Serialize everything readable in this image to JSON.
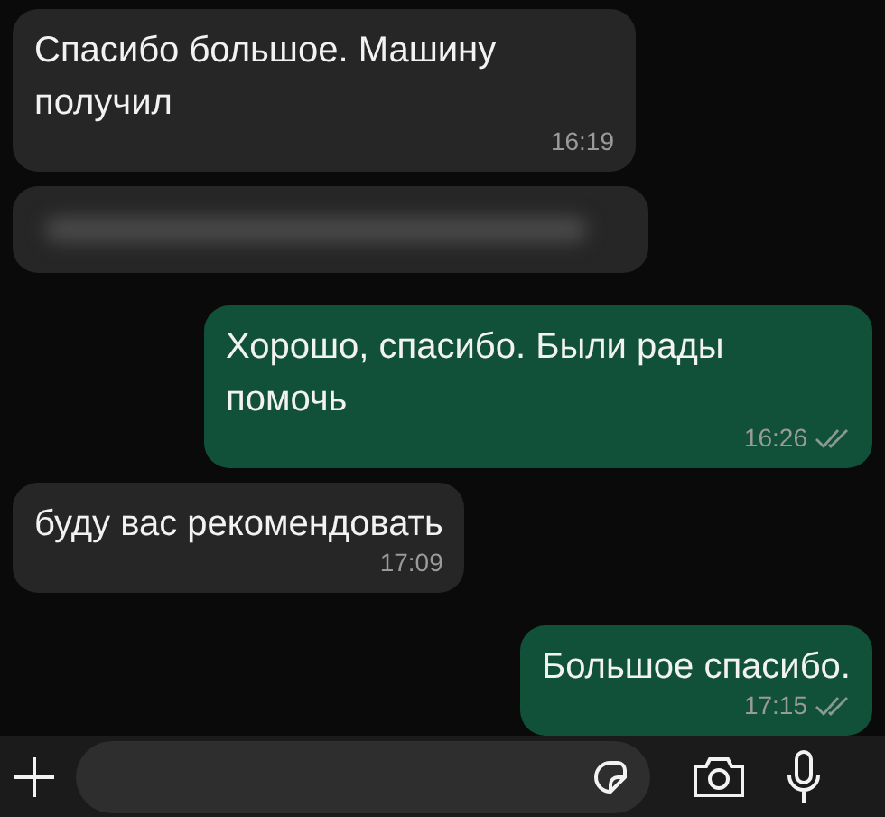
{
  "messages": [
    {
      "kind": "text",
      "outgoing": false,
      "text": "Спасибо большое. Машину получил",
      "time": "16:19"
    },
    {
      "kind": "blurred",
      "outgoing": false
    },
    {
      "kind": "text",
      "outgoing": true,
      "text": "Хорошо, спасибо. Были рады помочь",
      "time": "16:26",
      "delivered": true
    },
    {
      "kind": "text",
      "outgoing": false,
      "text": "буду вас рекомендовать",
      "time": "17:09"
    },
    {
      "kind": "text",
      "outgoing": true,
      "text": "Большое спасибо.",
      "time": "17:15",
      "delivered": true
    }
  ]
}
